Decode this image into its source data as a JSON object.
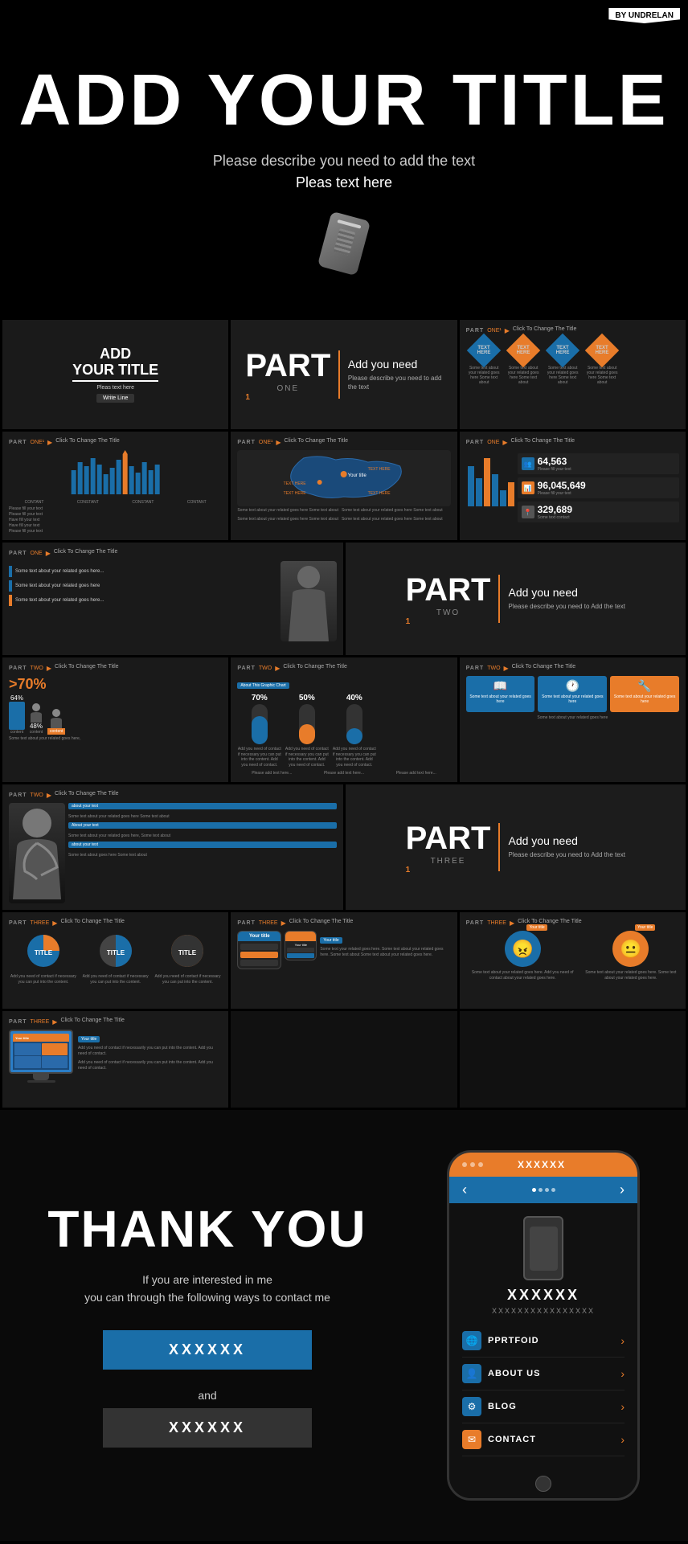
{
  "badge": "BY UNDRELAN",
  "hero": {
    "title": "ADD YOUR TITLE",
    "subtitle": "Please describe you need to add the text",
    "sub2": "Pleas text here"
  },
  "slides": {
    "part_one_title": {
      "line1": "ADD",
      "line2": "YOUR TITLE",
      "sub": "Pleas text here",
      "btn": "Write Line"
    },
    "part_one_center": {
      "label": "PART",
      "num": "ONE",
      "title": "Add you need",
      "desc": "Please describe you need to add the text"
    },
    "part_one_diamonds": {
      "label": "PART",
      "num": "ONE",
      "click": "Click To Change The Title",
      "items": [
        {
          "label": "TEXT HERE",
          "type": "blue"
        },
        {
          "label": "TEXT HERE",
          "type": "orange"
        },
        {
          "label": "TEXT HERE",
          "type": "blue"
        },
        {
          "label": "TEXT HERE",
          "type": "orange"
        }
      ]
    },
    "stats": {
      "label": "PART ONE",
      "click": "Click To Change The Title",
      "items": [
        {
          "number": "64,563",
          "label": "Please fill your text"
        },
        {
          "number": "96,045,649",
          "label": "Please fill your text"
        },
        {
          "number": "329,689",
          "label": "Some text contact"
        }
      ]
    }
  },
  "part_two": {
    "label": "PART TWO",
    "title_center": {
      "label": "PART",
      "num": "TWO",
      "title": "Add you need",
      "desc": "Please describe you need to Add the text"
    },
    "pcts": [
      {
        "pct": "70%",
        "color": "blue"
      },
      {
        "pct": "50%",
        "color": "orange"
      },
      {
        "pct": "40%",
        "color": "blue"
      }
    ]
  },
  "part_three": {
    "label": "PART THREE",
    "title_center": {
      "label": "PART",
      "num": "THREE",
      "title": "Add you need",
      "desc": "Please describe you need to Add the text"
    }
  },
  "thank_you": {
    "title": "THANK YOU",
    "desc1": "If you are interested in me",
    "desc2": "you can through the following ways to contact me",
    "btn1": "XXXXXX",
    "and": "and",
    "btn2": "XXXXXX"
  },
  "phone": {
    "top_title": "XXXXXX",
    "content_title": "XXXXXX",
    "content_sub": "XXXXXXXXXXXXXXXX",
    "menu_items": [
      {
        "label": "PPRTFOID",
        "icon": "🌐",
        "type": "blue"
      },
      {
        "label": "ABOUT US",
        "icon": "👤",
        "type": "blue"
      },
      {
        "label": "BLOG",
        "icon": "⚙",
        "type": "blue"
      },
      {
        "label": "CONTACT",
        "icon": "✉",
        "type": "orange"
      }
    ]
  },
  "bar_labels": [
    "CONTANT",
    "CONSTANT",
    "CONSTANT",
    "CONTANT"
  ],
  "chart_pcts": [
    "70%",
    "50%",
    "40%"
  ],
  "person_slide_texts": [
    "Some text about your related goes here...",
    "Some text about your related goes here",
    "Some text about your related goes here..."
  ],
  "about_chart": "About This Graphic Chart",
  "content_labels": [
    "content",
    "content",
    "content"
  ]
}
